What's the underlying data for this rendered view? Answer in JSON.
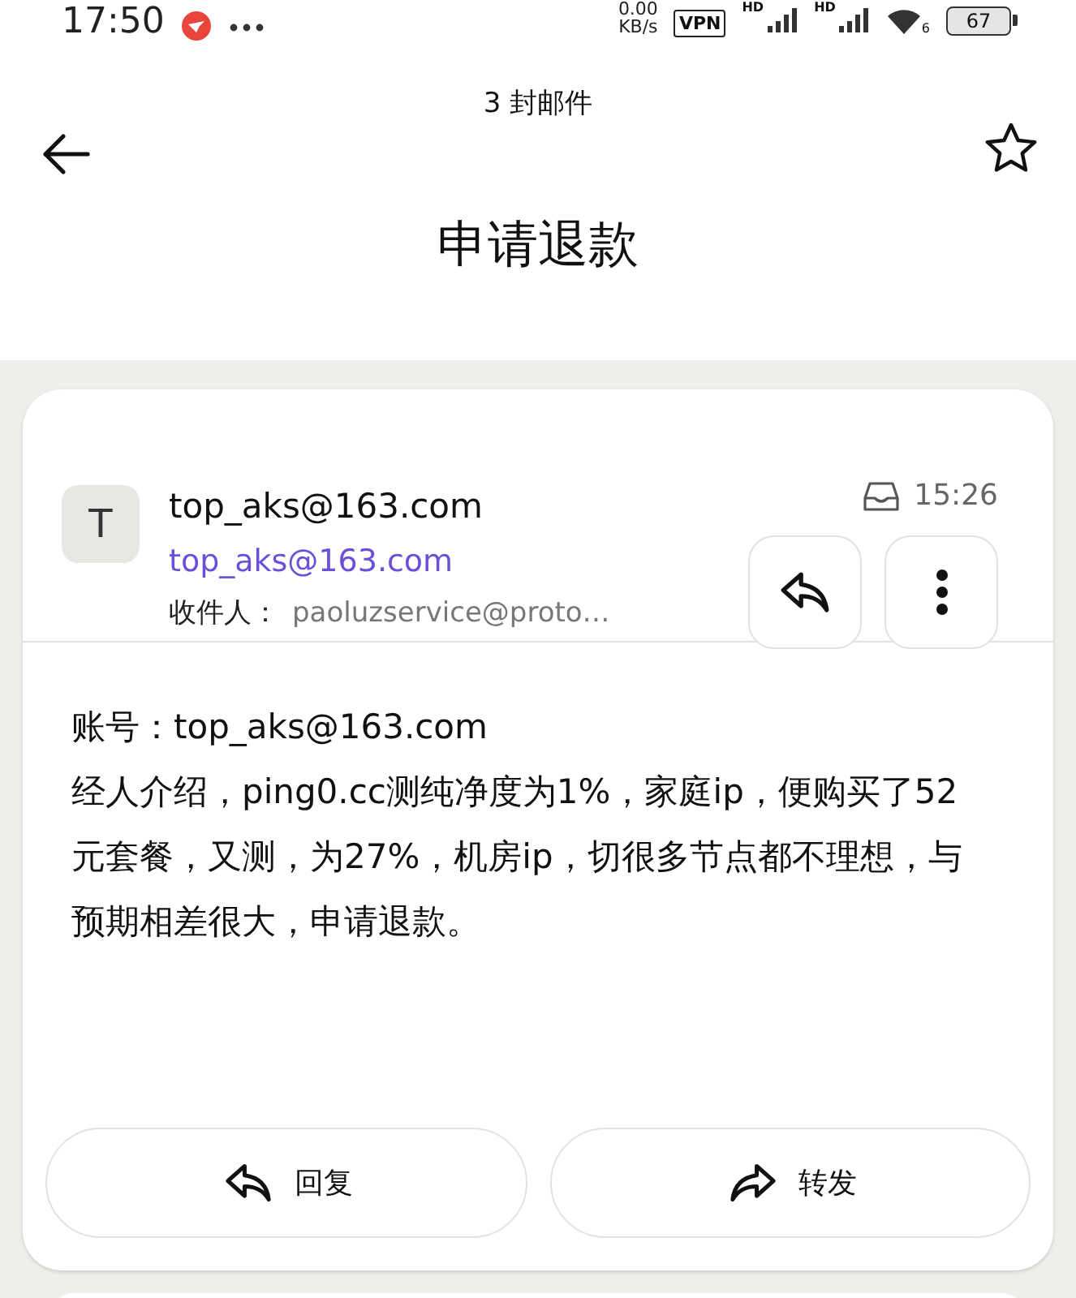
{
  "status_bar": {
    "time": "17:50",
    "speed_value": "0.00",
    "speed_unit": "KB/s",
    "vpn": "VPN",
    "signal_labels": [
      "HD",
      "HD"
    ],
    "wifi_label": "6",
    "battery": "67"
  },
  "header": {
    "count": "3 封邮件",
    "title": "申请退款",
    "starred": false
  },
  "message": {
    "avatar": "T",
    "sender_name": "top_aks@163.com",
    "sender_address": "top_aks@163.com",
    "recipient_label": "收件人：",
    "recipient": "paoluzservice@proto…",
    "time": "15:26",
    "body": [
      "账号：top_aks@163.com",
      "经人介绍，ping0.cc测纯净度为1%，家庭ip，便购买了52元套餐，又测，为27%，机房ip，切很多节点都不理想，与预期相差很大，申请退款。"
    ]
  },
  "actions": [
    {
      "kind": "reply",
      "label": "回复"
    },
    {
      "kind": "forward",
      "label": "转发"
    }
  ]
}
